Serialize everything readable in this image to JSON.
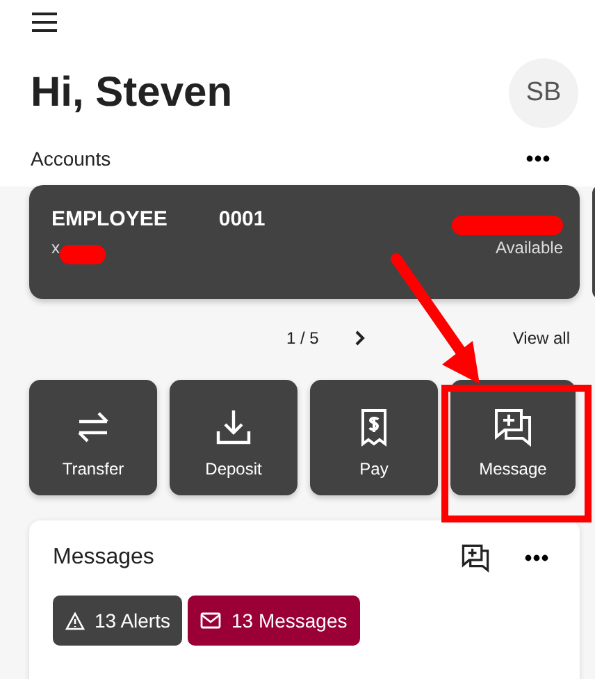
{
  "greeting": "Hi, Steven",
  "avatar": "SB",
  "accounts": {
    "title": "Accounts",
    "cards": [
      {
        "name": "EMPLOYEE",
        "number": "0001",
        "mask": "x",
        "balance_label": "Available"
      }
    ],
    "pager": "1 / 5",
    "view_all": "View all"
  },
  "actions": [
    {
      "kind": "transfer",
      "label": "Transfer"
    },
    {
      "kind": "deposit",
      "label": "Deposit"
    },
    {
      "kind": "pay",
      "label": "Pay"
    },
    {
      "kind": "message",
      "label": "Message"
    }
  ],
  "messages": {
    "title": "Messages",
    "chips": [
      {
        "kind": "alerts",
        "label": "13 Alerts",
        "color": "#424242"
      },
      {
        "kind": "messages",
        "label": "13 Messages",
        "color": "#9a0036"
      }
    ]
  }
}
